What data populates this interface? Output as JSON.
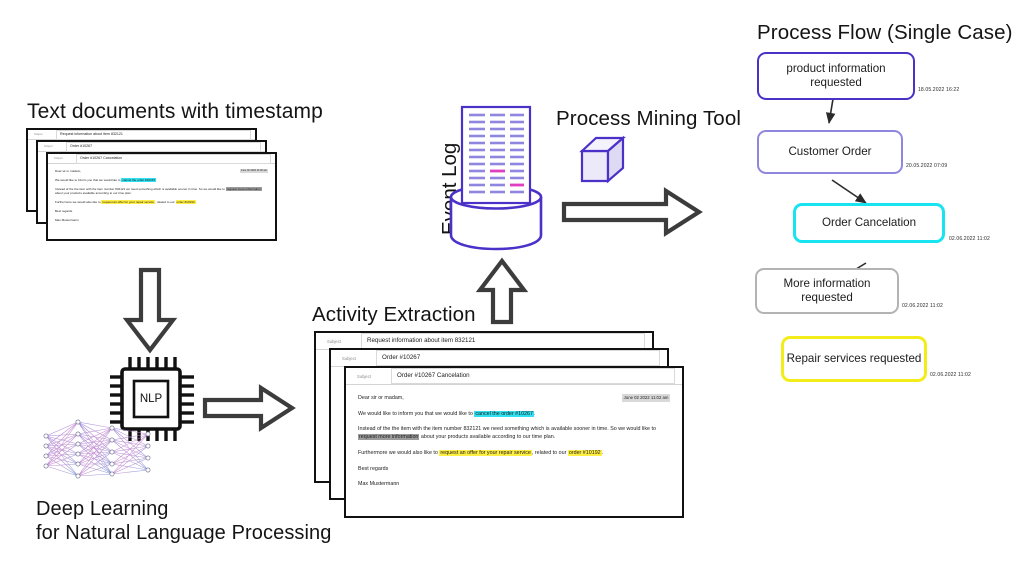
{
  "headings": {
    "text_documents": "Text documents with timestamp",
    "deep_learning_line1": "Deep Learning",
    "deep_learning_line2": "for Natural Language Processing",
    "activity_extraction": "Activity Extraction",
    "event_log": "Event Log",
    "process_mining_tool": "Process Mining Tool",
    "process_flow": "Process Flow (Single Case)"
  },
  "chip": {
    "label": "NLP"
  },
  "email": {
    "subject_label": "Subject",
    "subjects": [
      "Request information about item 832121",
      "Order #10267",
      "Order #10267 Cancelation"
    ],
    "timestamp": "June 02 2022 11:02 am",
    "greeting": "Dear sir or madam,",
    "p1_before": "We would like to inform you that we would like to ",
    "p1_highlight": "cancel the order #10267",
    "p1_after": ".",
    "p2_before": "Instead of the the item with the item number 832121 we need something which is available sooner in time. So we would like to ",
    "p2_highlight": "request more information",
    "p2_after": " about your products available according to our time plan.",
    "p3_before": "Furthermore we would also like to ",
    "p3_highlight_a": "request an offer for your repair service",
    "p3_middle": ", related to our ",
    "p3_highlight_b": "order #10192",
    "p3_after": ".",
    "signoff": "Best regards",
    "sender": "Max Mustermann"
  },
  "process_flow": {
    "steps": [
      {
        "label": "product information requested",
        "timestamp": "18.05.2022 16:22",
        "color": "#4b31c8"
      },
      {
        "label": "Customer Order",
        "timestamp": "20.05.2022 07:09",
        "color": "#8f86e0"
      },
      {
        "label": "Order Cancelation",
        "timestamp": "02.06.2022 11:02",
        "color": "#18e3f0"
      },
      {
        "label": "More information requested",
        "timestamp": "02.06.2022 11:02",
        "color": "#b3b3b3"
      },
      {
        "label": "Repair services requested",
        "timestamp": "02.06.2022 11:02",
        "color": "#f2ed1a"
      }
    ]
  },
  "colors": {
    "highlight_cyan": "#31e0f0",
    "highlight_yellow": "#ffee44",
    "highlight_gray": "#9c9c9c",
    "accent_purple": "#5b43d6",
    "arrow_outline": "#3c3c3c"
  }
}
